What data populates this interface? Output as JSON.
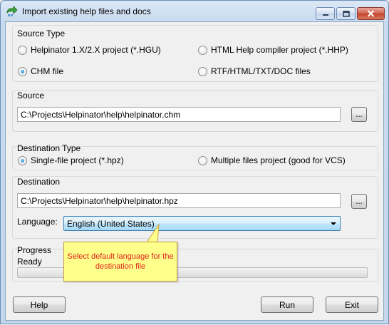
{
  "window": {
    "title": "Import existing help files and docs"
  },
  "source_type": {
    "title": "Source Type",
    "options": [
      {
        "label": "Helpinator 1.X/2.X project (*.HGU)",
        "selected": false
      },
      {
        "label": "HTML Help compiler project (*.HHP)",
        "selected": false
      },
      {
        "label": "CHM file",
        "selected": true
      },
      {
        "label": "RTF/HTML/TXT/DOC files",
        "selected": false
      }
    ]
  },
  "source": {
    "title": "Source",
    "path": "C:\\Projects\\Helpinator\\help\\helpinator.chm",
    "browse_label": "..."
  },
  "destination_type": {
    "title": "Destination Type",
    "options": [
      {
        "label": "Single-file project (*.hpz)",
        "selected": true
      },
      {
        "label": "Multiple files project (good for VCS)",
        "selected": false
      }
    ]
  },
  "destination": {
    "title": "Destination",
    "path": "C:\\Projects\\Helpinator\\help\\helpinator.hpz",
    "browse_label": "...",
    "language_label": "Language:",
    "language_value": "English (United States)"
  },
  "progress": {
    "title": "Progress",
    "status": "Ready",
    "fraction": 0
  },
  "callout": {
    "text": "Select default language for the destination file",
    "color": "#e0201a",
    "background": "#ffff8c"
  },
  "buttons": {
    "help": "Help",
    "run": "Run",
    "exit": "Exit"
  }
}
